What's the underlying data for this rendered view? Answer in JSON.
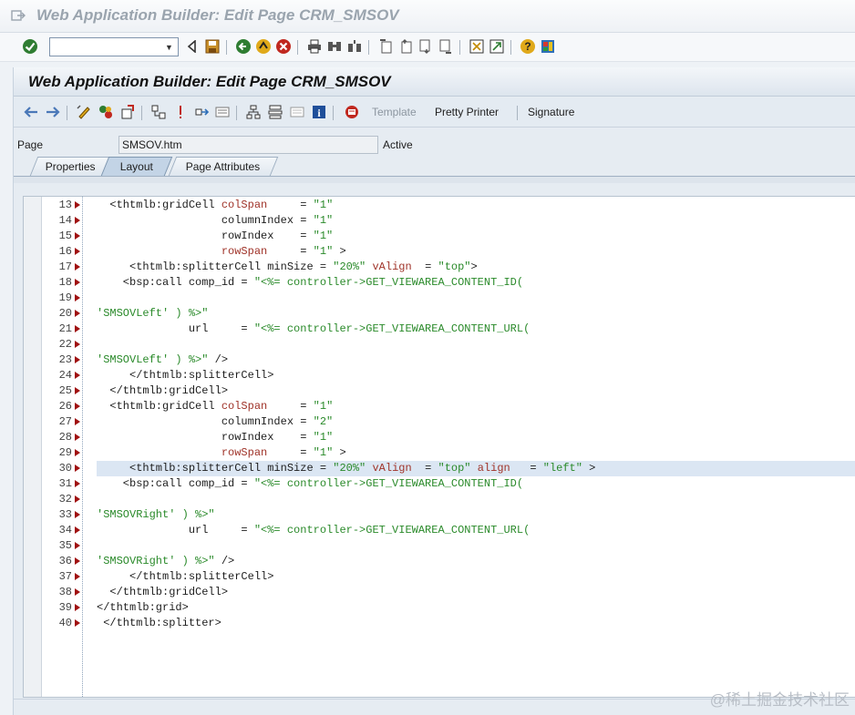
{
  "window": {
    "title": "Web Application Builder: Edit Page CRM_SMSOV",
    "command_field_value": ""
  },
  "app": {
    "title": "Web Application Builder: Edit Page CRM_SMSOV",
    "toolbar": {
      "template_label": "Template",
      "pretty_printer_label": "Pretty Printer",
      "signature_label": "Signature"
    }
  },
  "page_field": {
    "label": "Page",
    "value": "SMSOV.htm",
    "status": "Active"
  },
  "tabs": [
    {
      "label": "Properties",
      "active": false
    },
    {
      "label": "Layout",
      "active": true
    },
    {
      "label": "Page Attributes",
      "active": false
    }
  ],
  "editor": {
    "highlighted_line": "30",
    "lines": [
      {
        "n": "13",
        "segs": [
          [
            "p",
            "  <thtmlb:gridCell "
          ],
          [
            "a",
            "colSpan"
          ],
          [
            "p",
            "     = "
          ],
          [
            "s",
            "\"1\""
          ]
        ]
      },
      {
        "n": "14",
        "segs": [
          [
            "p",
            "                   columnIndex = "
          ],
          [
            "s",
            "\"1\""
          ]
        ]
      },
      {
        "n": "15",
        "segs": [
          [
            "p",
            "                   rowIndex    = "
          ],
          [
            "s",
            "\"1\""
          ]
        ]
      },
      {
        "n": "16",
        "segs": [
          [
            "p",
            "                   "
          ],
          [
            "a",
            "rowSpan"
          ],
          [
            "p",
            "     = "
          ],
          [
            "s",
            "\"1\""
          ],
          [
            "p",
            " >"
          ]
        ]
      },
      {
        "n": "17",
        "segs": [
          [
            "p",
            "     <thtmlb:splitterCell minSize = "
          ],
          [
            "s",
            "\"20%\""
          ],
          [
            "p",
            " "
          ],
          [
            "a",
            "vAlign"
          ],
          [
            "p",
            "  = "
          ],
          [
            "s",
            "\"top\""
          ],
          [
            "p",
            ">"
          ]
        ]
      },
      {
        "n": "18",
        "segs": [
          [
            "p",
            "    <bsp:call comp_id = "
          ],
          [
            "s",
            "\"<%= controller->GET_VIEWAREA_CONTENT_ID("
          ]
        ]
      },
      {
        "n": "19",
        "segs": []
      },
      {
        "n": "20",
        "segs": [
          [
            "s",
            "'SMSOVLeft' ) %>\""
          ]
        ]
      },
      {
        "n": "21",
        "segs": [
          [
            "p",
            "              url     = "
          ],
          [
            "s",
            "\"<%= controller->GET_VIEWAREA_CONTENT_URL("
          ]
        ]
      },
      {
        "n": "22",
        "segs": []
      },
      {
        "n": "23",
        "segs": [
          [
            "s",
            "'SMSOVLeft' ) %>\""
          ],
          [
            "p",
            " />"
          ]
        ]
      },
      {
        "n": "24",
        "segs": [
          [
            "p",
            "     </thtmlb:splitterCell>"
          ]
        ]
      },
      {
        "n": "25",
        "segs": [
          [
            "p",
            "  </thtmlb:gridCell>"
          ]
        ]
      },
      {
        "n": "26",
        "segs": [
          [
            "p",
            "  <thtmlb:gridCell "
          ],
          [
            "a",
            "colSpan"
          ],
          [
            "p",
            "     = "
          ],
          [
            "s",
            "\"1\""
          ]
        ]
      },
      {
        "n": "27",
        "segs": [
          [
            "p",
            "                   columnIndex = "
          ],
          [
            "s",
            "\"2\""
          ]
        ]
      },
      {
        "n": "28",
        "segs": [
          [
            "p",
            "                   rowIndex    = "
          ],
          [
            "s",
            "\"1\""
          ]
        ]
      },
      {
        "n": "29",
        "segs": [
          [
            "p",
            "                   "
          ],
          [
            "a",
            "rowSpan"
          ],
          [
            "p",
            "     = "
          ],
          [
            "s",
            "\"1\""
          ],
          [
            "p",
            " >"
          ]
        ]
      },
      {
        "n": "30",
        "segs": [
          [
            "p",
            "     <thtmlb:splitterCell minSize = "
          ],
          [
            "s",
            "\"20%\""
          ],
          [
            "p",
            " "
          ],
          [
            "a",
            "vAlign"
          ],
          [
            "p",
            "  = "
          ],
          [
            "s",
            "\"top\""
          ],
          [
            "p",
            " "
          ],
          [
            "a",
            "align"
          ],
          [
            "p",
            "   = "
          ],
          [
            "s",
            "\"left\""
          ],
          [
            "p",
            " >"
          ]
        ]
      },
      {
        "n": "31",
        "segs": [
          [
            "p",
            "    <bsp:call comp_id = "
          ],
          [
            "s",
            "\"<%= controller->GET_VIEWAREA_CONTENT_ID("
          ]
        ]
      },
      {
        "n": "32",
        "segs": []
      },
      {
        "n": "33",
        "segs": [
          [
            "s",
            "'SMSOVRight' ) %>\""
          ]
        ]
      },
      {
        "n": "34",
        "segs": [
          [
            "p",
            "              url     = "
          ],
          [
            "s",
            "\"<%= controller->GET_VIEWAREA_CONTENT_URL("
          ]
        ]
      },
      {
        "n": "35",
        "segs": []
      },
      {
        "n": "36",
        "segs": [
          [
            "s",
            "'SMSOVRight' ) %>\""
          ],
          [
            "p",
            " />"
          ]
        ]
      },
      {
        "n": "37",
        "segs": [
          [
            "p",
            "     </thtmlb:splitterCell>"
          ]
        ]
      },
      {
        "n": "38",
        "segs": [
          [
            "p",
            "  </thtmlb:gridCell>"
          ]
        ]
      },
      {
        "n": "39",
        "segs": [
          [
            "p",
            "</thtmlb:grid>"
          ]
        ]
      },
      {
        "n": "40",
        "segs": [
          [
            "p",
            " </thtmlb:splitter>"
          ]
        ]
      }
    ]
  },
  "watermark": "@稀土掘金技术社区",
  "colors": {
    "attribute": "#a0342a",
    "string": "#2a8a2a",
    "highlight": "#dbe6f3"
  }
}
